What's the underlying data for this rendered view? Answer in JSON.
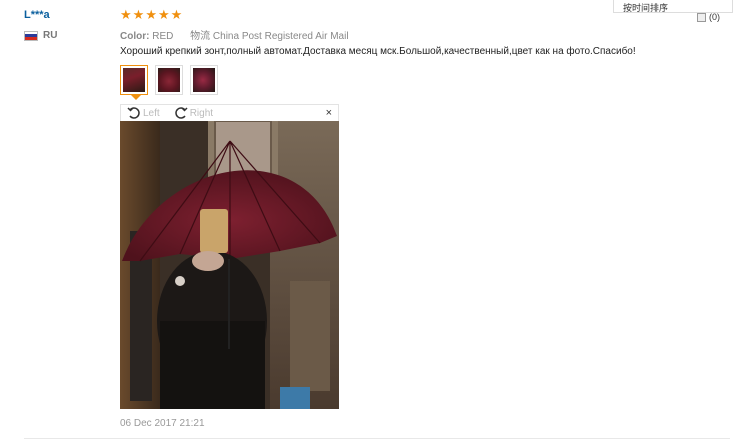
{
  "reviewer": {
    "name": "L***a",
    "country": "RU",
    "flag_colors": [
      "#ffffff",
      "#2b3b9a",
      "#d52b1e"
    ]
  },
  "review": {
    "stars": 5,
    "star_glyph": "★",
    "color_label": "Color:",
    "color_value": "RED",
    "shipping_label": "物流",
    "shipping_value": "China Post Registered Air Mail",
    "text": "Хороший крепкий зонт,полный автомат.Доставка месяц мск.Большой,качественный,цвет как на фото.Спасибо!",
    "date": "06 Dec 2017 21:21"
  },
  "viewer": {
    "rotate_left": "Left",
    "rotate_right": "Right",
    "close": "×"
  },
  "sort": {
    "label": "按时间排序",
    "count": "(0)"
  },
  "colors": {
    "accent": "#f0900f",
    "link": "#0a5f9e",
    "umbrella": "#6e1a26"
  }
}
